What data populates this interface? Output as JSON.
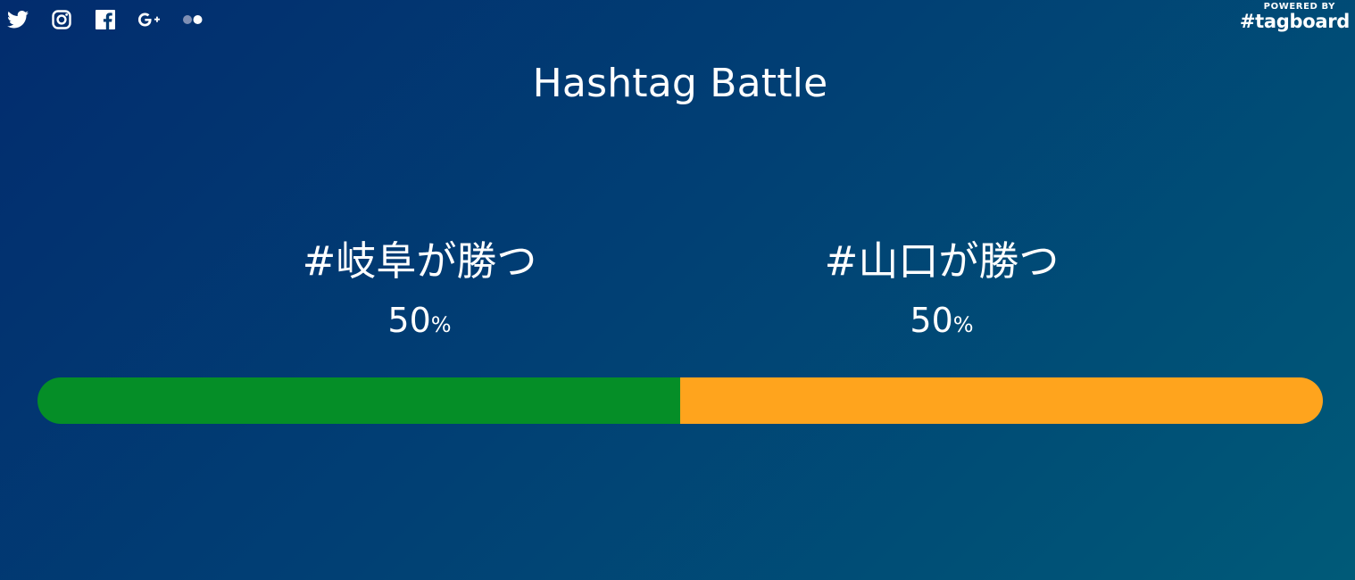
{
  "social": {
    "icons": [
      "twitter-icon",
      "instagram-icon",
      "facebook-icon",
      "google-plus-icon",
      "flickr-icon"
    ]
  },
  "powered": {
    "label": "POWERED BY",
    "brand": "#tagboard"
  },
  "title": "Hashtag Battle",
  "contestants": [
    {
      "tag": "#岐阜が勝つ",
      "percent": "50",
      "percent_symbol": "%",
      "color": "#058e27"
    },
    {
      "tag": "#山口が勝つ",
      "percent": "50",
      "percent_symbol": "%",
      "color": "#ffa41d"
    }
  ],
  "bar": {
    "left_fraction": 0.5,
    "right_fraction": 0.5
  }
}
